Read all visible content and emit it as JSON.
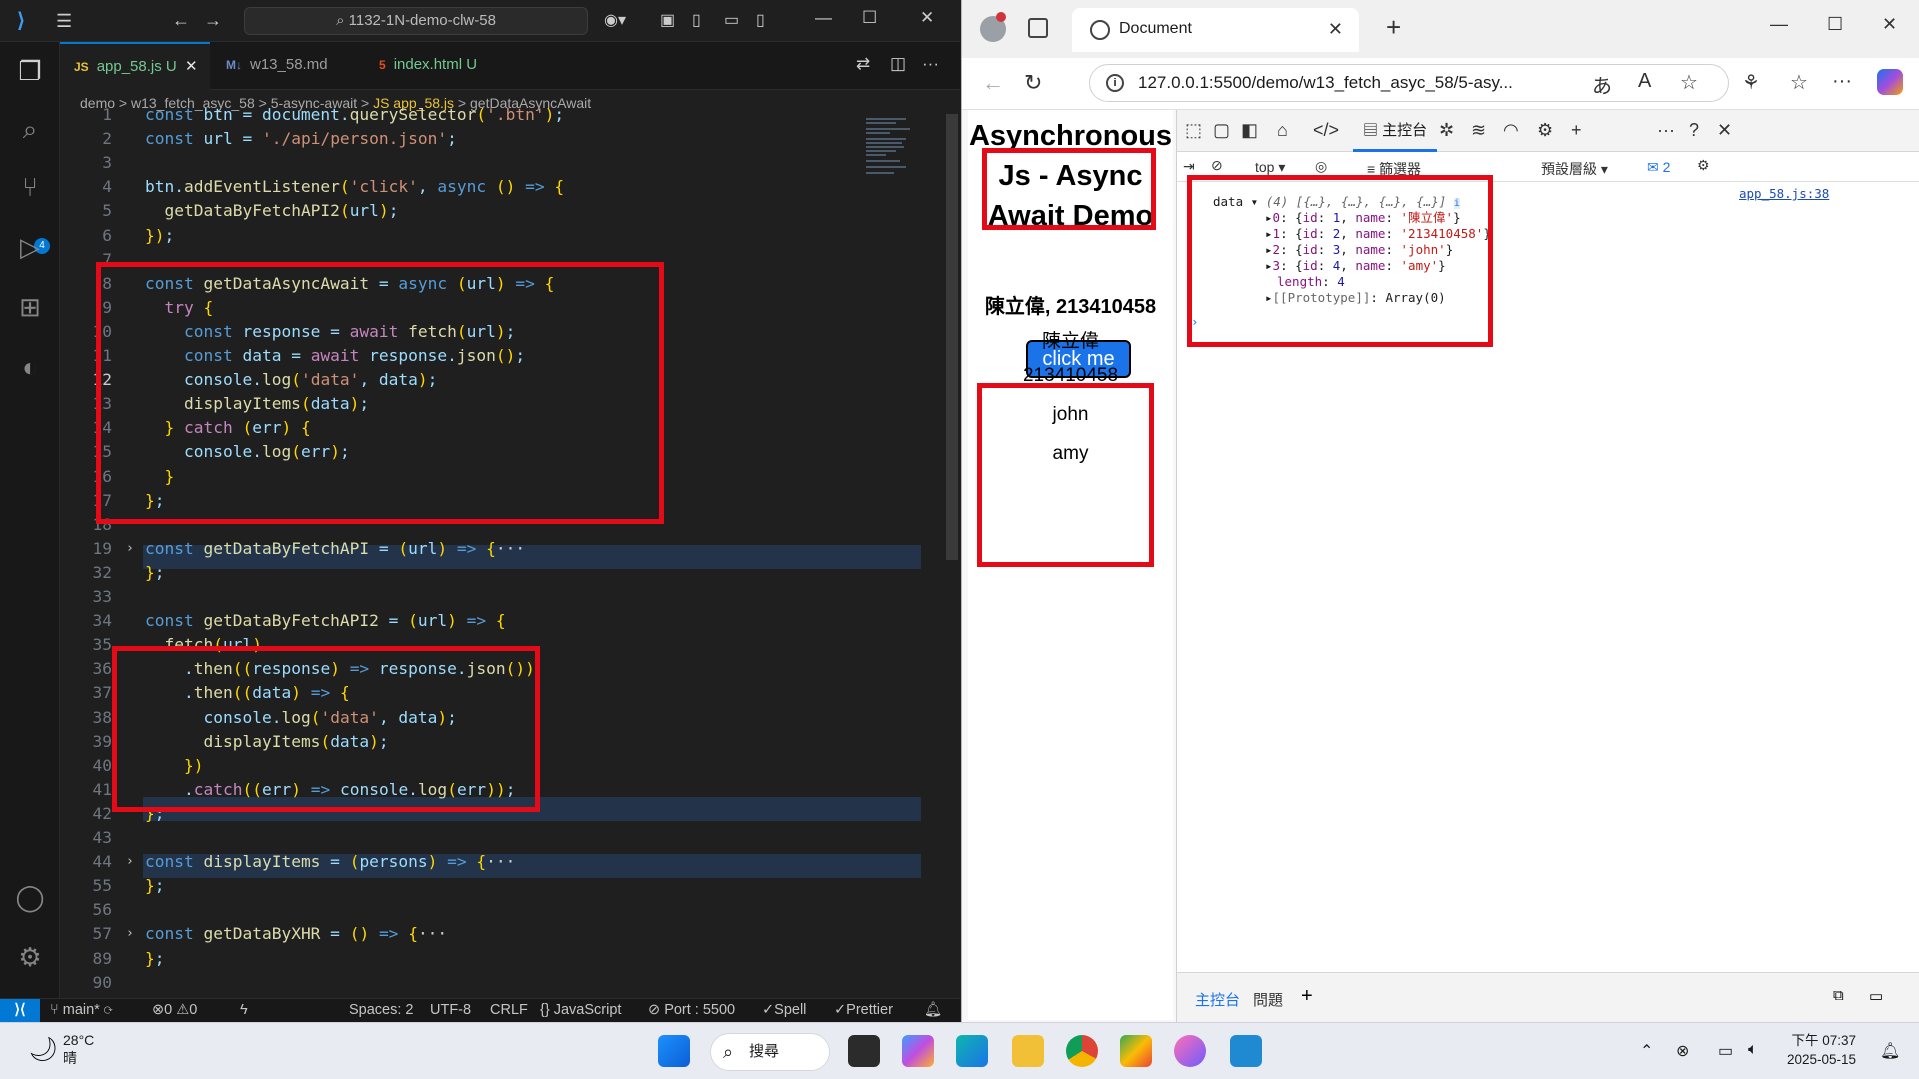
{
  "vscode": {
    "search_text": "1132-1N-demo-clw-58",
    "tabs": [
      {
        "icon": "JS",
        "label": "app_58.js",
        "marker": "U",
        "active": true
      },
      {
        "icon": "M↓",
        "label": "w13_58.md",
        "marker": ""
      },
      {
        "icon": "5",
        "label": "index.html",
        "marker": "U"
      }
    ],
    "breadcrumb": [
      "demo",
      "w13_fetch_asyc_58",
      "5-async-await",
      "JS app_58.js",
      "getDataAsyncAwait"
    ],
    "code": [
      {
        "n": "1",
        "t": "const btn = document.querySelector('.btn');"
      },
      {
        "n": "2",
        "t": "const url = './api/person.json';"
      },
      {
        "n": "3",
        "t": ""
      },
      {
        "n": "4",
        "t": "btn.addEventListener('click', async () => {"
      },
      {
        "n": "5",
        "t": "  getDataByFetchAPI2(url);"
      },
      {
        "n": "6",
        "t": "});"
      },
      {
        "n": "7",
        "t": ""
      },
      {
        "n": "8",
        "t": "const getDataAsyncAwait = async (url) => {"
      },
      {
        "n": "9",
        "t": "  try {"
      },
      {
        "n": "10",
        "t": "    const response = await fetch(url);"
      },
      {
        "n": "11",
        "t": "    const data = await response.json();"
      },
      {
        "n": "12",
        "t": "    console.log('data', data);"
      },
      {
        "n": "13",
        "t": "    displayItems(data);"
      },
      {
        "n": "14",
        "t": "  } catch (err) {"
      },
      {
        "n": "15",
        "t": "    console.log(err);"
      },
      {
        "n": "16",
        "t": "  }"
      },
      {
        "n": "17",
        "t": "};"
      },
      {
        "n": "18",
        "t": ""
      },
      {
        "n": "19",
        "t": "const getDataByFetchAPI = (url) => {···"
      },
      {
        "n": "32",
        "t": "};"
      },
      {
        "n": "33",
        "t": ""
      },
      {
        "n": "34",
        "t": "const getDataByFetchAPI2 = (url) => {"
      },
      {
        "n": "35",
        "t": "  fetch(url)"
      },
      {
        "n": "36",
        "t": "    .then((response) => response.json())"
      },
      {
        "n": "37",
        "t": "    .then((data) => {"
      },
      {
        "n": "38",
        "t": "      console.log('data', data);"
      },
      {
        "n": "39",
        "t": "      displayItems(data);"
      },
      {
        "n": "40",
        "t": "    })"
      },
      {
        "n": "41",
        "t": "    .catch((err) => console.log(err));"
      },
      {
        "n": "42",
        "t": "};"
      },
      {
        "n": "43",
        "t": ""
      },
      {
        "n": "44",
        "t": "const displayItems = (persons) => {···"
      },
      {
        "n": "55",
        "t": "};"
      },
      {
        "n": "56",
        "t": ""
      },
      {
        "n": "57",
        "t": "const getDataByXHR = () => {···"
      },
      {
        "n": "89",
        "t": "};"
      },
      {
        "n": "90",
        "t": ""
      }
    ],
    "status": {
      "branch": "main*",
      "problems": "0",
      "warnings": "0",
      "spaces": "Spaces: 2",
      "encoding": "UTF-8",
      "eol": "CRLF",
      "language": "JavaScript",
      "port": "Port : 5500",
      "spell": "Spell",
      "prettier": "Prettier"
    }
  },
  "edge": {
    "tab_title": "Document",
    "url": "127.0.0.1:5500/demo/w13_fetch_asyc_58/5-asy...",
    "page": {
      "heading_lines": [
        "Asynchronous",
        "Js - Async",
        "Await Demo"
      ],
      "subheading": "陳立偉, 213410458",
      "button": "click me",
      "items": [
        "陳立偉",
        "213410458",
        "john",
        "amy"
      ]
    },
    "devtools": {
      "console_tab": "主控台",
      "context": "top",
      "filter": "篩選器",
      "levels": "預設層級",
      "issues_count": "2",
      "source_link": "app_58.js:38",
      "drawer_console": "主控台",
      "drawer_issues": "問題",
      "log": {
        "label": "data",
        "summary": "(4) [{…}, {…}, {…}, {…}]",
        "rows": [
          {
            "idx": "0",
            "id": "1",
            "name": "'陳立偉'"
          },
          {
            "idx": "1",
            "id": "2",
            "name": "'213410458'"
          },
          {
            "idx": "2",
            "id": "3",
            "name": "'john'"
          },
          {
            "idx": "3",
            "id": "4",
            "name": "'amy'"
          }
        ],
        "length_key": "length",
        "length_val": "4",
        "proto_key": "[[Prototype]]",
        "proto_val": "Array(0)"
      }
    }
  },
  "taskbar": {
    "temp": "28°C",
    "weather": "晴",
    "search": "搜尋",
    "time": "下午 07:37",
    "date": "2025-05-15"
  },
  "colors": {
    "annotation_red": "#e30b18",
    "vscode_accent": "#0078d4",
    "edge_button": "#1a73e8"
  }
}
